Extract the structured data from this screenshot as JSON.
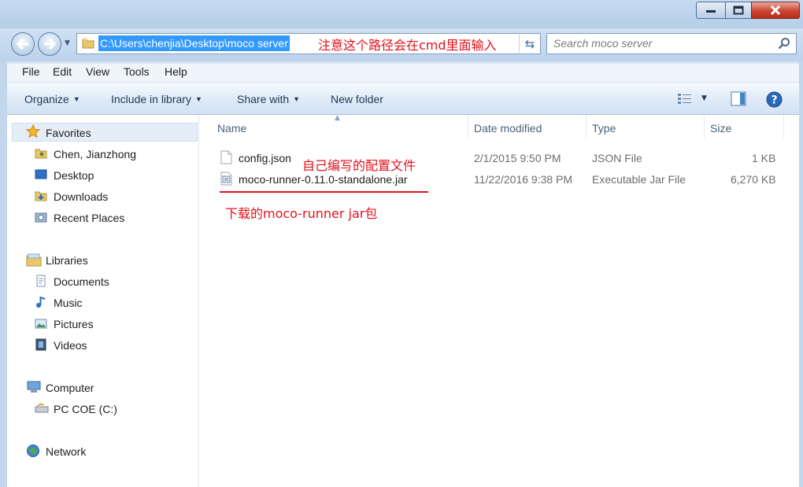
{
  "window": {
    "buttons": {
      "minimize_icon": "minimize-icon",
      "maximize_icon": "maximize-icon",
      "close_icon": "close-icon"
    }
  },
  "address": {
    "path": "C:\\Users\\chenjia\\Desktop\\moco server",
    "annotation": "注意这个路径会在cmd里面输入",
    "folder_icon": "folder-icon",
    "refresh_icon": "refresh-icon"
  },
  "search": {
    "placeholder": "Search moco server",
    "icon": "search-icon"
  },
  "menu": [
    "File",
    "Edit",
    "View",
    "Tools",
    "Help"
  ],
  "commands": {
    "organize": "Organize",
    "include_in_library": "Include in library",
    "share_with": "Share with",
    "new_folder": "New folder"
  },
  "nav": {
    "favorites": {
      "header": "Favorites",
      "items": [
        "Chen, Jianzhong",
        "Desktop",
        "Downloads",
        "Recent Places"
      ]
    },
    "libraries": {
      "header": "Libraries",
      "items": [
        "Documents",
        "Music",
        "Pictures",
        "Videos"
      ]
    },
    "computer": {
      "header": "Computer",
      "items": [
        "PC COE (C:)"
      ]
    },
    "network": {
      "header": "Network"
    }
  },
  "columns": [
    "Name",
    "Date modified",
    "Type",
    "Size"
  ],
  "files": [
    {
      "name": "config.json",
      "date": "2/1/2015 9:50 PM",
      "type": "JSON File",
      "size": "1 KB",
      "icon": "json-file-icon"
    },
    {
      "name": "moco-runner-0.11.0-standalone.jar",
      "date": "11/22/2016 9:38 PM",
      "type": "Executable Jar File",
      "size": "6,270 KB",
      "icon": "jar-file-icon"
    }
  ],
  "annotations": {
    "config": "自己编写的配置文件",
    "jar": "下载的moco-runner  jar包",
    "color": "#e3121c"
  },
  "colors": {
    "selection": "#3399ff",
    "frame": "#c6daf0"
  }
}
